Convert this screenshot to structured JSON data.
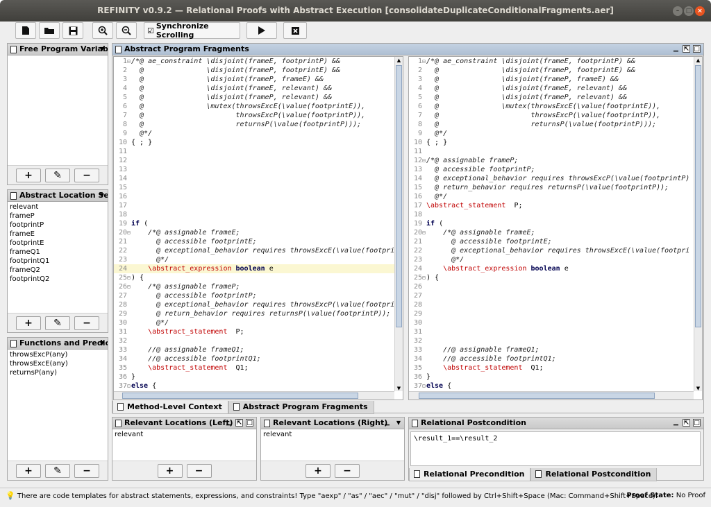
{
  "window": {
    "title": "REFINITY v0.9.2 — Relational Proofs with Abstract Execution [consolidateDuplicateConditionalFragments.aer]"
  },
  "toolbar": {
    "sync_label": "Synchronize Scrolling",
    "sync_checked": "☑"
  },
  "icons": {
    "new": "new-file-icon",
    "open": "open-folder-icon",
    "save": "save-icon",
    "zoom_in": "zoom-in-icon",
    "zoom_out": "zoom-out-icon",
    "run": "play-icon",
    "stop": "stop-icon"
  },
  "left": {
    "free_vars": {
      "title": "Free Program Variabl",
      "items": []
    },
    "abstract_locs": {
      "title": "Abstract Location Set",
      "items": [
        "relevant",
        "frameP",
        "footprintP",
        "frameE",
        "footprintE",
        "frameQ1",
        "footprintQ1",
        "frameQ2",
        "footprintQ2"
      ]
    },
    "functions": {
      "title": "Functions and Predic",
      "items": [
        "throwsExcP(any)",
        "throwsExcE(any)",
        "returnsP(any)"
      ]
    }
  },
  "fragments": {
    "title": "Abstract Program Fragments"
  },
  "editor_left": [
    {
      "n": "1",
      "f": "⊟",
      "t": [
        [
          "cm",
          "/*@ ae_constraint \\disjoint(frameE, footprintP) &&"
        ]
      ]
    },
    {
      "n": "2",
      "f": "",
      "t": [
        [
          "cm",
          "  @               \\disjoint(frameP, footprintE) &&"
        ]
      ]
    },
    {
      "n": "3",
      "f": "",
      "t": [
        [
          "cm",
          "  @               \\disjoint(frameP, frameE) &&"
        ]
      ]
    },
    {
      "n": "4",
      "f": "",
      "t": [
        [
          "cm",
          "  @               \\disjoint(frameE, relevant) &&"
        ]
      ]
    },
    {
      "n": "5",
      "f": "",
      "t": [
        [
          "cm",
          "  @               \\disjoint(frameP, relevant) &&"
        ]
      ]
    },
    {
      "n": "6",
      "f": "",
      "t": [
        [
          "cm",
          "  @               \\mutex(throwsExcE(\\value(footprintE)),"
        ]
      ]
    },
    {
      "n": "7",
      "f": "",
      "t": [
        [
          "cm",
          "  @                      throwsExcP(\\value(footprintP)),"
        ]
      ]
    },
    {
      "n": "8",
      "f": "",
      "t": [
        [
          "cm",
          "  @                      returnsP(\\value(footprintP)));"
        ]
      ]
    },
    {
      "n": "9",
      "f": "",
      "t": [
        [
          "cm",
          "  @*/"
        ]
      ]
    },
    {
      "n": "10",
      "f": "",
      "t": [
        [
          "",
          "{ ; }"
        ]
      ]
    },
    {
      "n": "11",
      "f": "",
      "t": []
    },
    {
      "n": "12",
      "f": "",
      "t": []
    },
    {
      "n": "13",
      "f": "",
      "t": []
    },
    {
      "n": "14",
      "f": "",
      "t": []
    },
    {
      "n": "15",
      "f": "",
      "t": []
    },
    {
      "n": "16",
      "f": "",
      "t": []
    },
    {
      "n": "17",
      "f": "",
      "t": []
    },
    {
      "n": "18",
      "f": "",
      "t": []
    },
    {
      "n": "19",
      "f": "",
      "t": [
        [
          "kw",
          "if"
        ],
        [
          "",
          " ("
        ]
      ]
    },
    {
      "n": "20",
      "f": "⊟",
      "t": [
        [
          "cm",
          "    /*@ assignable frameE;"
        ]
      ]
    },
    {
      "n": "21",
      "f": "",
      "t": [
        [
          "cm",
          "      @ accessible footprintE;"
        ]
      ]
    },
    {
      "n": "22",
      "f": "",
      "t": [
        [
          "cm",
          "      @ exceptional_behavior requires throwsExcE(\\value(footpri"
        ]
      ]
    },
    {
      "n": "23",
      "f": "",
      "t": [
        [
          "cm",
          "      @*/"
        ]
      ]
    },
    {
      "n": "24",
      "f": "",
      "hl": true,
      "t": [
        [
          "rd",
          "    \\abstract_expression "
        ],
        [
          "kw",
          "boolean"
        ],
        [
          "",
          " e"
        ]
      ]
    },
    {
      "n": "25",
      "f": "⊟",
      "t": [
        [
          "",
          ") {"
        ]
      ]
    },
    {
      "n": "26",
      "f": "⊟",
      "t": [
        [
          "cm",
          "    /*@ assignable frameP;"
        ]
      ]
    },
    {
      "n": "27",
      "f": "",
      "t": [
        [
          "cm",
          "      @ accessible footprintP;"
        ]
      ]
    },
    {
      "n": "28",
      "f": "",
      "t": [
        [
          "cm",
          "      @ exceptional_behavior requires throwsExcP(\\value(footpri"
        ]
      ]
    },
    {
      "n": "29",
      "f": "",
      "t": [
        [
          "cm",
          "      @ return_behavior requires returnsP(\\value(footprintP));"
        ]
      ]
    },
    {
      "n": "30",
      "f": "",
      "t": [
        [
          "cm",
          "      @*/"
        ]
      ]
    },
    {
      "n": "31",
      "f": "",
      "t": [
        [
          "rd",
          "    \\abstract_statement "
        ],
        [
          "",
          " P;"
        ]
      ]
    },
    {
      "n": "32",
      "f": "",
      "t": []
    },
    {
      "n": "33",
      "f": "",
      "t": [
        [
          "cm",
          "    //@ assignable frameQ1;"
        ]
      ]
    },
    {
      "n": "34",
      "f": "",
      "t": [
        [
          "cm",
          "    //@ accessible footprintQ1;"
        ]
      ]
    },
    {
      "n": "35",
      "f": "",
      "t": [
        [
          "rd",
          "    \\abstract_statement "
        ],
        [
          "",
          " Q1;"
        ]
      ]
    },
    {
      "n": "36",
      "f": "",
      "t": [
        [
          "",
          "}"
        ]
      ]
    },
    {
      "n": "37",
      "f": "⊟",
      "t": [
        [
          "kw",
          "else"
        ],
        [
          "",
          " {"
        ]
      ]
    }
  ],
  "editor_right": [
    {
      "n": "1",
      "f": "⊟",
      "t": [
        [
          "cm",
          "/*@ ae_constraint \\disjoint(frameE, footprintP) &&"
        ]
      ]
    },
    {
      "n": "2",
      "f": "",
      "t": [
        [
          "cm",
          "  @               \\disjoint(frameP, footprintE) &&"
        ]
      ]
    },
    {
      "n": "3",
      "f": "",
      "t": [
        [
          "cm",
          "  @               \\disjoint(frameP, frameE) &&"
        ]
      ]
    },
    {
      "n": "4",
      "f": "",
      "t": [
        [
          "cm",
          "  @               \\disjoint(frameE, relevant) &&"
        ]
      ]
    },
    {
      "n": "5",
      "f": "",
      "t": [
        [
          "cm",
          "  @               \\disjoint(frameP, relevant) &&"
        ]
      ]
    },
    {
      "n": "6",
      "f": "",
      "t": [
        [
          "cm",
          "  @               \\mutex(throwsExcE(\\value(footprintE)),"
        ]
      ]
    },
    {
      "n": "7",
      "f": "",
      "t": [
        [
          "cm",
          "  @                      throwsExcP(\\value(footprintP)),"
        ]
      ]
    },
    {
      "n": "8",
      "f": "",
      "t": [
        [
          "cm",
          "  @                      returnsP(\\value(footprintP)));"
        ]
      ]
    },
    {
      "n": "9",
      "f": "",
      "t": [
        [
          "cm",
          "  @*/"
        ]
      ]
    },
    {
      "n": "10",
      "f": "",
      "t": [
        [
          "",
          "{ ; }"
        ]
      ]
    },
    {
      "n": "11",
      "f": "",
      "t": []
    },
    {
      "n": "12",
      "f": "⊟",
      "t": [
        [
          "cm",
          "/*@ assignable frameP;"
        ]
      ]
    },
    {
      "n": "13",
      "f": "",
      "t": [
        [
          "cm",
          "  @ accessible footprintP;"
        ]
      ]
    },
    {
      "n": "14",
      "f": "",
      "t": [
        [
          "cm",
          "  @ exceptional_behavior requires throwsExcP(\\value(footprintP)"
        ]
      ]
    },
    {
      "n": "15",
      "f": "",
      "t": [
        [
          "cm",
          "  @ return_behavior requires returnsP(\\value(footprintP));"
        ]
      ]
    },
    {
      "n": "16",
      "f": "",
      "t": [
        [
          "cm",
          "  @*/"
        ]
      ]
    },
    {
      "n": "17",
      "f": "",
      "t": [
        [
          "rd",
          "\\abstract_statement "
        ],
        [
          "",
          " P;"
        ]
      ]
    },
    {
      "n": "18",
      "f": "",
      "t": []
    },
    {
      "n": "19",
      "f": "",
      "t": [
        [
          "kw",
          "if"
        ],
        [
          "",
          " ("
        ]
      ]
    },
    {
      "n": "20",
      "f": "⊟",
      "t": [
        [
          "cm",
          "    /*@ assignable frameE;"
        ]
      ]
    },
    {
      "n": "21",
      "f": "",
      "t": [
        [
          "cm",
          "      @ accessible footprintE;"
        ]
      ]
    },
    {
      "n": "22",
      "f": "",
      "t": [
        [
          "cm",
          "      @ exceptional_behavior requires throwsExcE(\\value(footpri"
        ]
      ]
    },
    {
      "n": "23",
      "f": "",
      "t": [
        [
          "cm",
          "      @*/"
        ]
      ]
    },
    {
      "n": "24",
      "f": "",
      "t": [
        [
          "rd",
          "    \\abstract_expression "
        ],
        [
          "kw",
          "boolean"
        ],
        [
          "",
          " e"
        ]
      ]
    },
    {
      "n": "25",
      "f": "⊟",
      "t": [
        [
          "",
          ") {"
        ]
      ]
    },
    {
      "n": "26",
      "f": "",
      "t": []
    },
    {
      "n": "27",
      "f": "",
      "t": []
    },
    {
      "n": "28",
      "f": "",
      "t": []
    },
    {
      "n": "29",
      "f": "",
      "t": []
    },
    {
      "n": "30",
      "f": "",
      "t": []
    },
    {
      "n": "31",
      "f": "",
      "t": []
    },
    {
      "n": "32",
      "f": "",
      "t": []
    },
    {
      "n": "33",
      "f": "",
      "t": [
        [
          "cm",
          "    //@ assignable frameQ1;"
        ]
      ]
    },
    {
      "n": "34",
      "f": "",
      "t": [
        [
          "cm",
          "    //@ accessible footprintQ1;"
        ]
      ]
    },
    {
      "n": "35",
      "f": "",
      "t": [
        [
          "rd",
          "    \\abstract_statement "
        ],
        [
          "",
          " Q1;"
        ]
      ]
    },
    {
      "n": "36",
      "f": "",
      "t": [
        [
          "",
          "}"
        ]
      ]
    },
    {
      "n": "37",
      "f": "⊟",
      "t": [
        [
          "kw",
          "else"
        ],
        [
          "",
          " {"
        ]
      ]
    }
  ],
  "center_tabs": [
    "Method-Level Context",
    "Abstract Program Fragments"
  ],
  "relevant_left": {
    "title": "Relevant Locations (Left)",
    "items": [
      "relevant"
    ]
  },
  "relevant_right": {
    "title": "Relevant Locations (Right)",
    "items": [
      "relevant"
    ]
  },
  "postcond": {
    "title": "Relational Postcondition",
    "text": "\\result_1==\\result_2",
    "tabs": [
      "Relational Precondition",
      "Relational Postcondition"
    ]
  },
  "status": {
    "text": "There are code templates for abstract statements, expressions, and constraints! Type \"aexp\" / \"as\" / \"aec\" / \"mut\" / \"disj\" followed by Ctrl+Shift+Space (Mac: Command+Shift+Space).",
    "proof_label": "Proof State:",
    "proof_value": "No Proof"
  }
}
